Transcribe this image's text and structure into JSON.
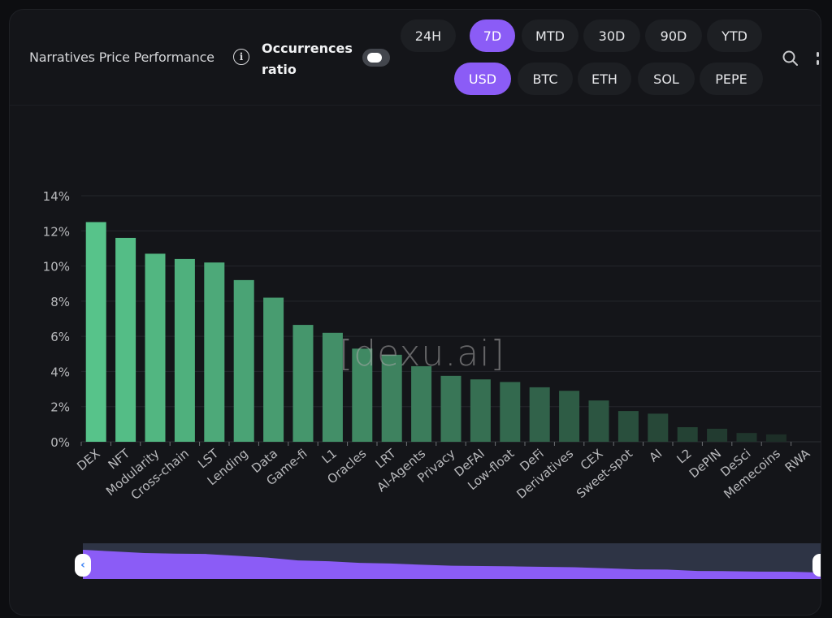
{
  "header": {
    "title": "Narratives Price Performance",
    "info_icon": "info-icon",
    "occurrences_label_line1": "Occurrences",
    "occurrences_label_line2": "ratio",
    "occurrences_toggle_on": false
  },
  "timeframes": [
    {
      "label": "24H",
      "active": false
    },
    {
      "label": "7D",
      "active": true
    },
    {
      "label": "MTD",
      "active": false
    },
    {
      "label": "30D",
      "active": false
    },
    {
      "label": "90D",
      "active": false
    },
    {
      "label": "YTD",
      "active": false
    }
  ],
  "currencies": [
    {
      "label": "USD",
      "active": true
    },
    {
      "label": "BTC",
      "active": false
    },
    {
      "label": "ETH",
      "active": false
    },
    {
      "label": "SOL",
      "active": false
    },
    {
      "label": "PEPE",
      "active": false
    }
  ],
  "icons": {
    "search": "search-icon",
    "more": "more-vertical-icon",
    "slider_left": "chevron-left-icon"
  },
  "watermark": "[dexu.ai]",
  "colors": {
    "accent": "#8b5cf6",
    "bar_top": "#57c38a",
    "bar_bottom": "#1a2823",
    "background": "#141519",
    "slider_track": "#2e3445"
  },
  "chart_data": {
    "type": "bar",
    "title": "Narratives Price Performance",
    "xlabel": "",
    "ylabel": "",
    "ylim": [
      0,
      14
    ],
    "yticks": [
      0,
      2,
      4,
      6,
      8,
      10,
      12,
      14
    ],
    "ytick_labels": [
      "0%",
      "2%",
      "4%",
      "6%",
      "8%",
      "10%",
      "12%",
      "14%"
    ],
    "grid": true,
    "legend": "none",
    "categories": [
      "DEX",
      "NFT",
      "Modularity",
      "Cross-chain",
      "LST",
      "Lending",
      "Data",
      "Game-fi",
      "L1",
      "Oracles",
      "LRT",
      "AI-Agents",
      "Privacy",
      "DeFAI",
      "Low-float",
      "DeFi",
      "Derivatives",
      "CEX",
      "Sweet-spot",
      "AI",
      "L2",
      "DePIN",
      "DeSci",
      "Memecoins",
      "RWA"
    ],
    "values": [
      12.5,
      11.6,
      10.7,
      10.4,
      10.2,
      9.2,
      8.2,
      6.65,
      6.2,
      5.3,
      4.95,
      4.3,
      3.75,
      3.55,
      3.4,
      3.1,
      2.9,
      2.35,
      1.75,
      1.6,
      0.83,
      0.74,
      0.5,
      0.42,
      0.0
    ],
    "unit": "%"
  }
}
